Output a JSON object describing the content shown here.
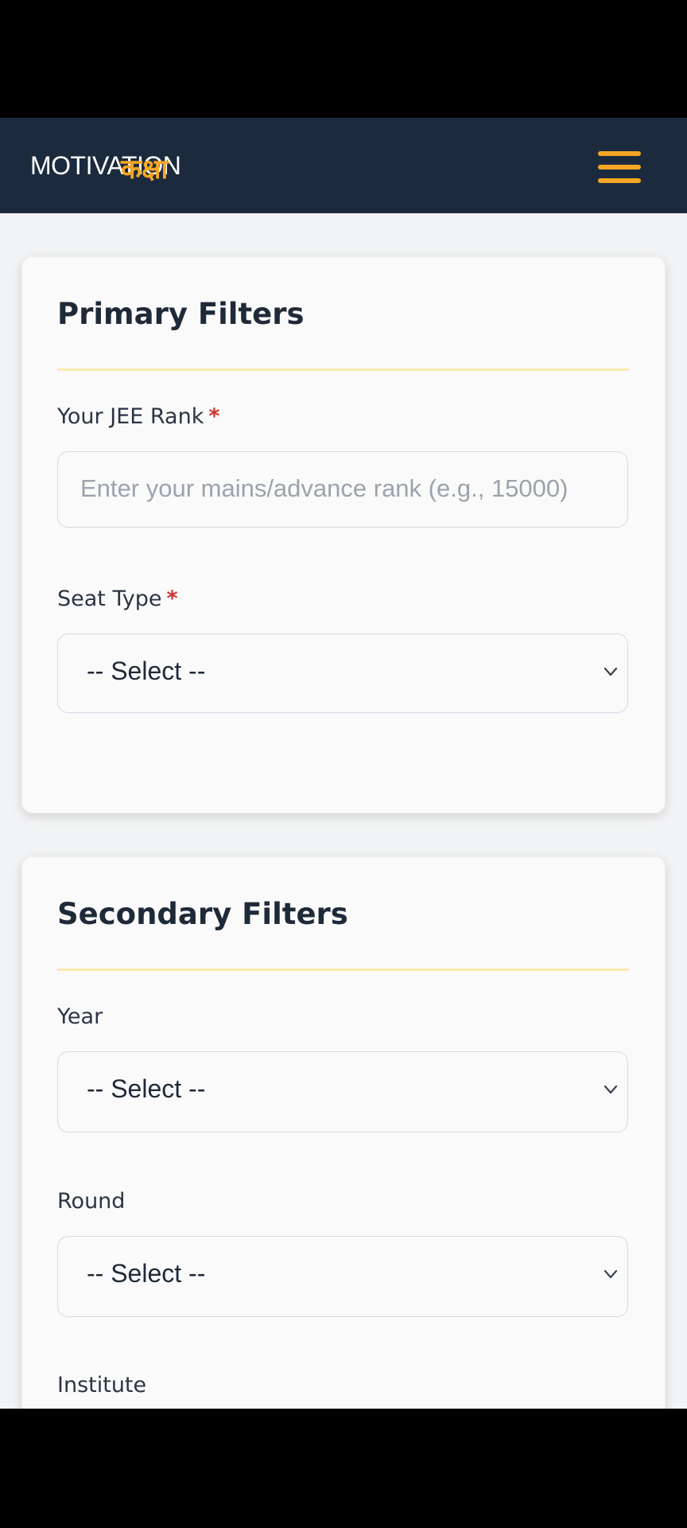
{
  "header": {
    "logo_main": "MOTIVATION",
    "logo_sub": "कक्षा",
    "menu_icon": "hamburger-menu-icon",
    "bg_color": "#1c2a3e",
    "accent_color": "#f6a623"
  },
  "primary": {
    "title": "Primary Filters",
    "rank_label": "Your JEE Rank",
    "rank_required": "*",
    "rank_placeholder": "Enter your mains/advance rank (e.g., 15000)",
    "seat_label": "Seat Type",
    "seat_required": "*",
    "seat_value": "-- Select --"
  },
  "secondary": {
    "title": "Secondary Filters",
    "year_label": "Year",
    "year_value": "-- Select --",
    "round_label": "Round",
    "round_value": "-- Select --",
    "institute_label": "Institute"
  }
}
